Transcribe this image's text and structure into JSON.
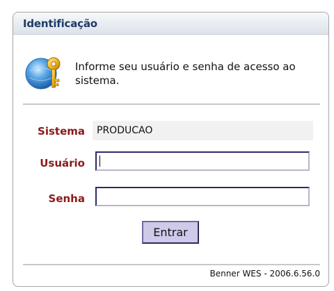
{
  "dialog": {
    "title": "Identificação",
    "info_text": "Informe seu usuário e senha de acesso ao sistema.",
    "info_icon": "security-key-icon"
  },
  "form": {
    "system_label": "Sistema",
    "system_value": "PRODUCAO",
    "user_label": "Usuário",
    "user_value": "",
    "password_label": "Senha",
    "password_value": "",
    "submit_label": "Entrar"
  },
  "footer": {
    "version_text": "Benner WES - 2006.6.56.0"
  },
  "colors": {
    "title": "#1f3a66",
    "label": "#8b1a1a",
    "button_bg": "#cfc9ea"
  }
}
